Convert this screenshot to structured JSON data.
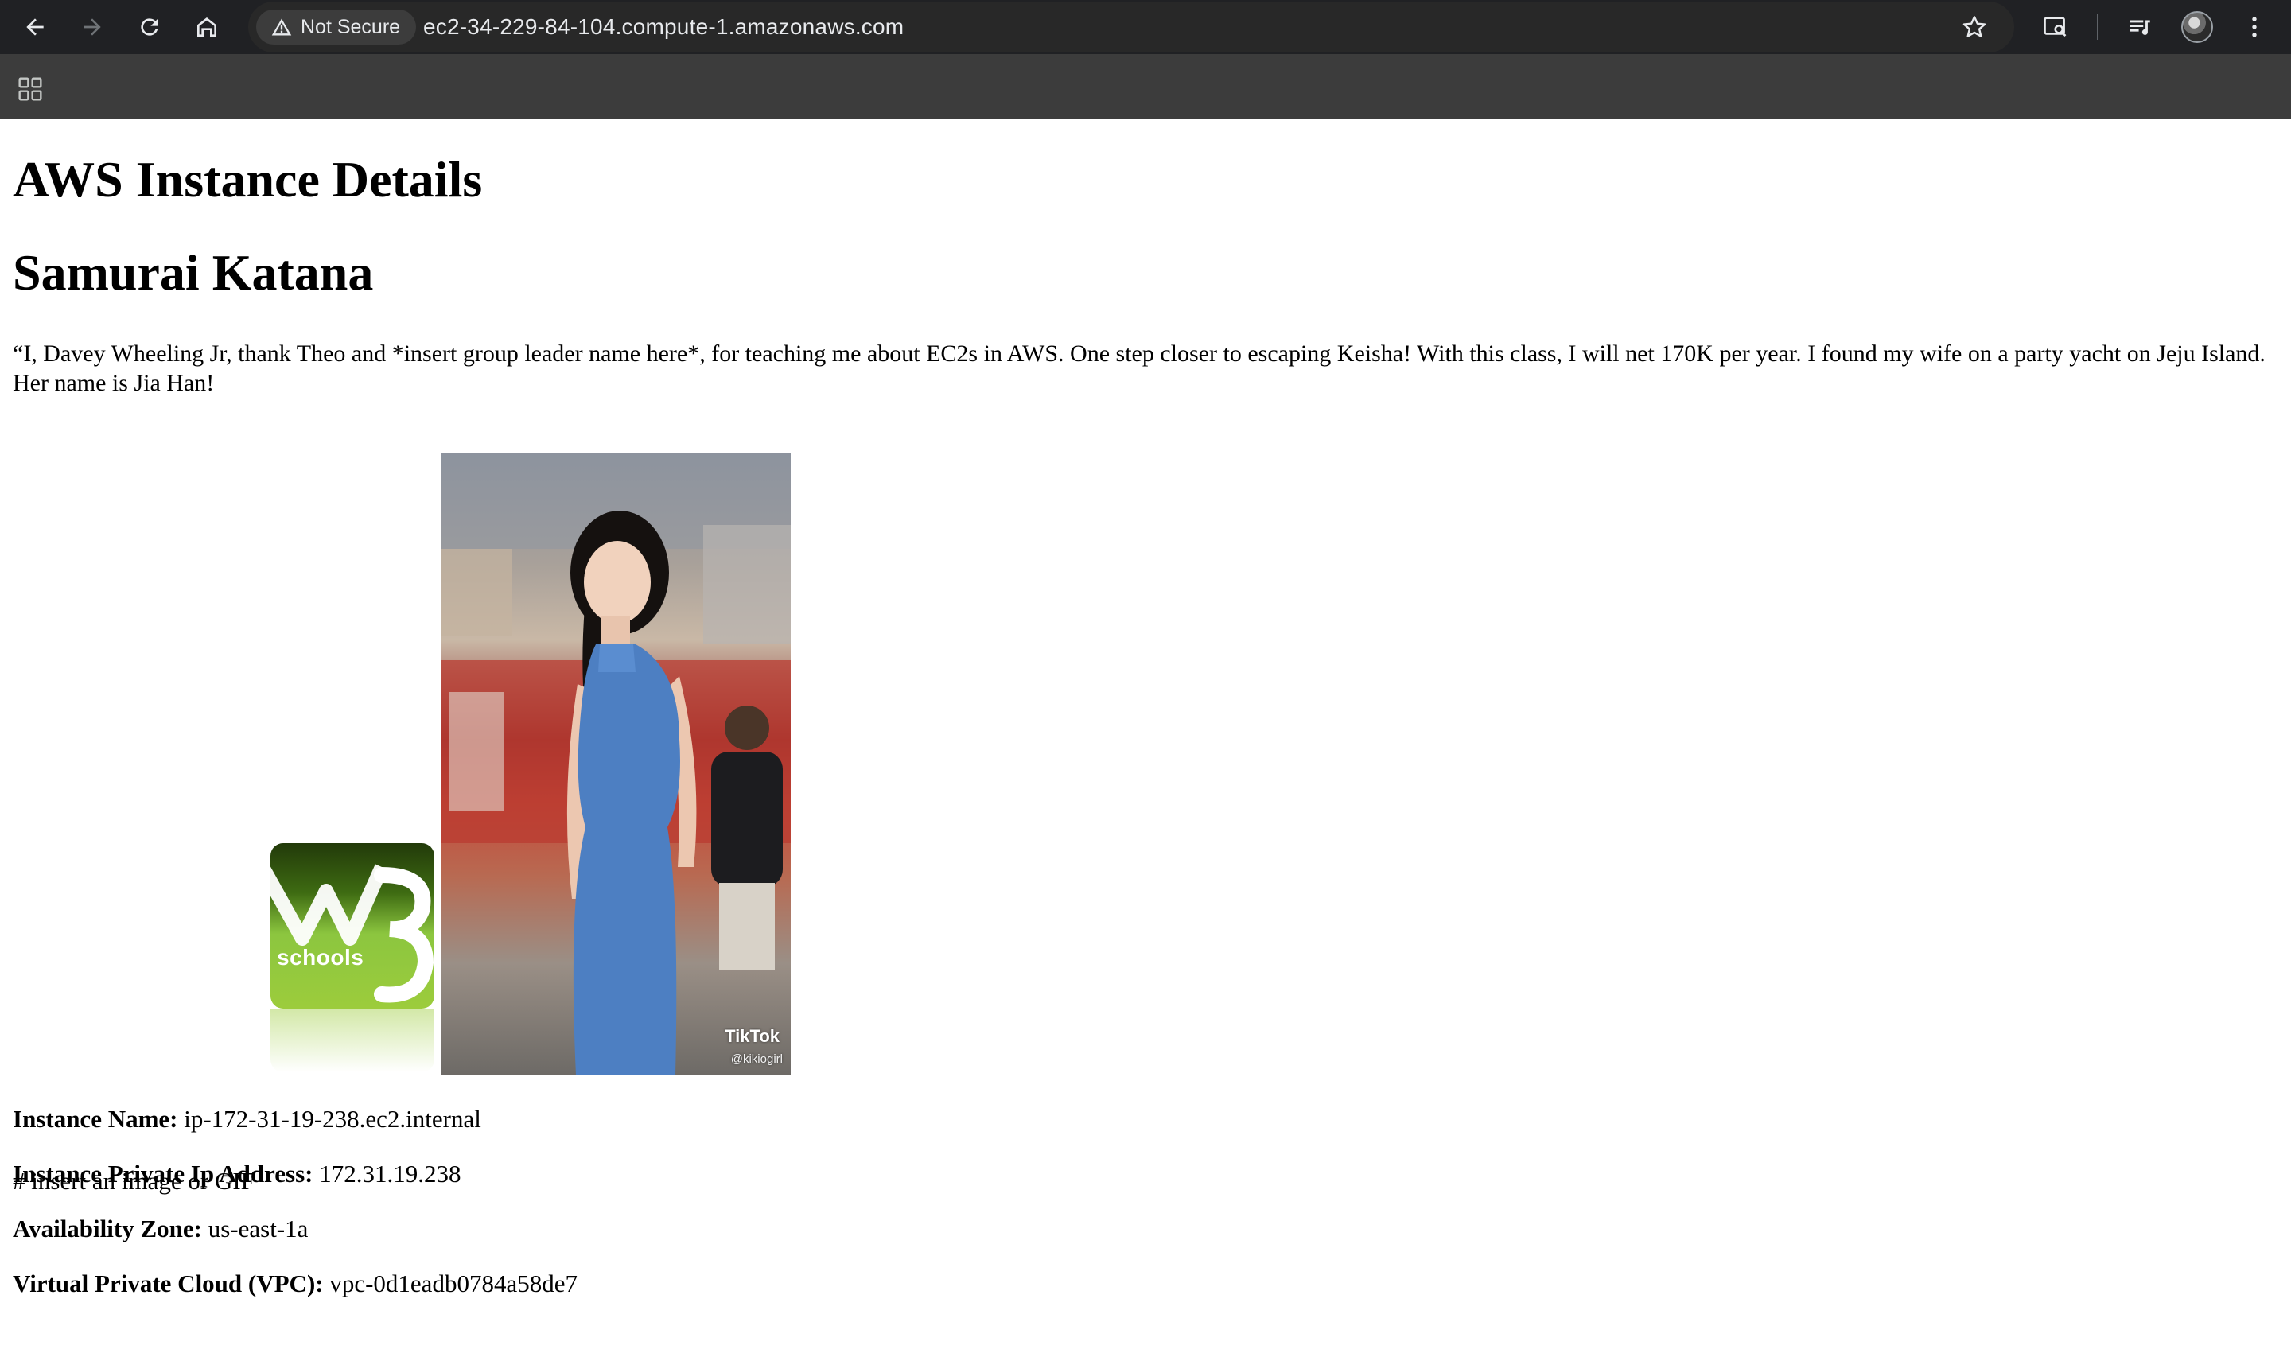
{
  "browser": {
    "security_label": "Not Secure",
    "url": "ec2-34-229-84-104.compute-1.amazonaws.com"
  },
  "page": {
    "title": "AWS Instance Details",
    "subtitle": "Samurai Katana",
    "quote": "“I, Davey Wheeling Jr, thank Theo and *insert group leader name here*, for teaching me about EC2s in AWS. One step closer to escaping Keisha! With this class, I will net 170K per year. I found my wife on a party yacht on Jeju Island. Her name is Jia Han!",
    "media_caption": "# insert an image or GIF",
    "w3_logo_text": "schools",
    "photo_watermark": "TikTok",
    "photo_handle": "@kikiogirl"
  },
  "details": [
    {
      "label": "Instance Name:",
      "value": "ip-172-31-19-238.ec2.internal"
    },
    {
      "label": "Instance Private Ip Address:",
      "value": "172.31.19.238"
    },
    {
      "label": "Availability Zone:",
      "value": "us-east-1a"
    },
    {
      "label": "Virtual Private Cloud (VPC):",
      "value": "vpc-0d1eadb0784a58de7"
    }
  ]
}
